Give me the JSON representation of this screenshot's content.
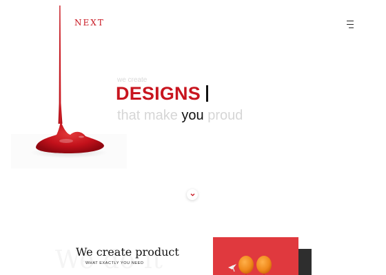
{
  "header": {
    "logo_text": "NEXT",
    "menu_icon": "hamburger-menu-icon"
  },
  "hero": {
    "kicker": "we create",
    "headline": "DESIGNS",
    "tagline_before": "that make ",
    "tagline_emphasis": "you",
    "tagline_after": " proud",
    "scroll_icon": "chevron-down-icon"
  },
  "section": {
    "background_word": "We do it",
    "title": "We create product",
    "subtitle": "WHAT EXACTLY YOU NEED"
  },
  "colors": {
    "accent": "#c8151f",
    "muted_text": "#d6d6d6",
    "dark_text": "#111111",
    "product_red": "#e0393e",
    "balloon_orange": "#f08a1c"
  }
}
